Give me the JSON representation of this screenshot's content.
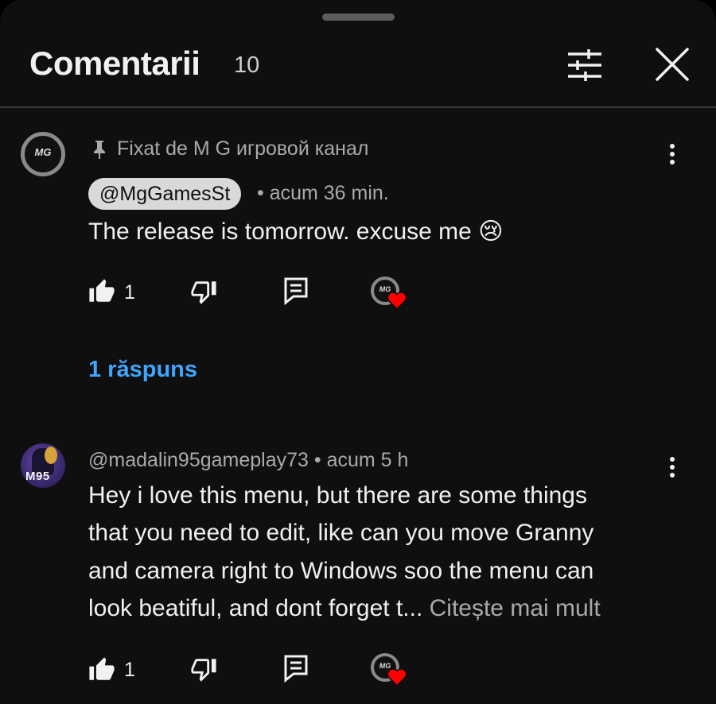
{
  "header": {
    "title": "Comentarii",
    "count": "10"
  },
  "comments": [
    {
      "pinned_label": "Fixat de M G игровой канал",
      "avatar_text": "MG",
      "author": "@MgGamesSt",
      "time": "• acum 36 min.",
      "text": "The release is tomorrow. excuse me 😢",
      "likes": "1",
      "replies_label": "1 răspuns",
      "hearted_avatar_text": "MG"
    },
    {
      "avatar_text": "M95",
      "author_meta": "@madalin95gameplay73 • acum 5 h",
      "text_lines": [
        "Hey i love this menu, but there are some things",
        "that you need to edit, like can you move Granny",
        "and camera right to Windows soo the menu can",
        "look beatiful, and dont forget t..."
      ],
      "read_more": "Citește mai mult",
      "likes": "1",
      "hearted_avatar_text": "MG"
    }
  ],
  "colors": {
    "background": "#0f0f0f",
    "text": "#f1f1f1",
    "secondary": "#aaaaaa",
    "link": "#3ea6ff",
    "heart": "#ff0000"
  },
  "icons": [
    "filter-icon",
    "close-icon",
    "pin-icon",
    "more-vert-icon",
    "thumb-up-icon",
    "thumb-down-icon",
    "reply-icon",
    "heart-icon"
  ]
}
